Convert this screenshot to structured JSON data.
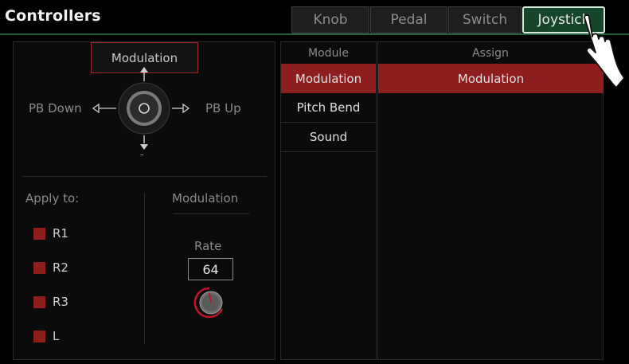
{
  "header": {
    "title": "Controllers",
    "tabs": [
      {
        "label": "Knob"
      },
      {
        "label": "Pedal"
      },
      {
        "label": "Switch"
      },
      {
        "label": "Joystick"
      }
    ],
    "active_tab": "Joystick"
  },
  "joystick": {
    "up_label": "Modulation",
    "left_label": "PB Down",
    "right_label": "PB Up",
    "down_label": "-"
  },
  "apply": {
    "title": "Apply to:",
    "parts": [
      "R1",
      "R2",
      "R3",
      "L"
    ]
  },
  "modulation": {
    "title": "Modulation",
    "rate_label": "Rate",
    "rate_value": "64"
  },
  "module_list": {
    "header": "Module",
    "items": [
      "Modulation",
      "Pitch Bend",
      "Sound"
    ],
    "selected": "Modulation"
  },
  "assign_list": {
    "header": "Assign",
    "items": [
      "Modulation"
    ]
  },
  "colors": {
    "accent_red": "#8e1d1d",
    "tab_active": "#15462a",
    "header_line": "#1f5f3a"
  }
}
